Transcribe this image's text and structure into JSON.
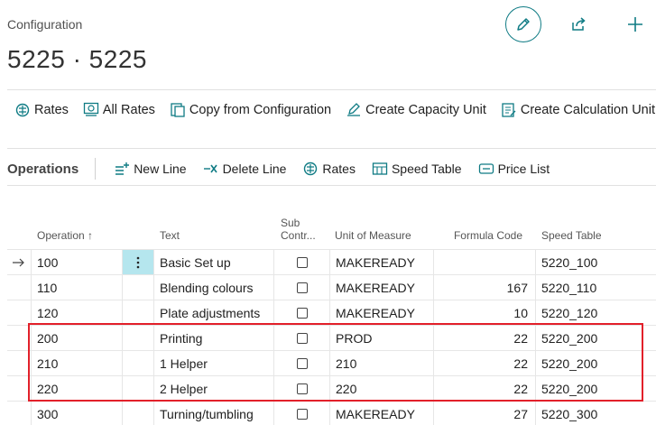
{
  "page": {
    "caption": "Configuration",
    "title": "5225 · 5225"
  },
  "top_actions": {
    "edit_icon": "pencil-icon",
    "share_icon": "share-icon",
    "new_icon": "plus-icon"
  },
  "action_bar": [
    {
      "label": "Rates",
      "icon": "rates-icon"
    },
    {
      "label": "All Rates",
      "icon": "all-rates-icon"
    },
    {
      "label": "Copy from Configuration",
      "icon": "copy-icon"
    },
    {
      "label": "Create Capacity Unit",
      "icon": "create-capacity-icon"
    },
    {
      "label": "Create Calculation Unit",
      "icon": "create-calculation-icon"
    }
  ],
  "operations": {
    "title": "Operations",
    "actions": [
      {
        "label": "New Line",
        "icon": "new-line-icon"
      },
      {
        "label": "Delete Line",
        "icon": "delete-line-icon"
      },
      {
        "label": "Rates",
        "icon": "rates-icon"
      },
      {
        "label": "Speed Table",
        "icon": "speed-table-icon"
      },
      {
        "label": "Price List",
        "icon": "price-list-icon"
      }
    ]
  },
  "table": {
    "columns": {
      "operation": "Operation ↑",
      "text": "Text",
      "sub_contr_1": "Sub",
      "sub_contr_2": "Contr...",
      "unit_of_measure": "Unit of Measure",
      "formula_code": "Formula Code",
      "speed_table": "Speed Table"
    },
    "rows": [
      {
        "operation": "100",
        "text": "Basic Set up",
        "sub_contr": false,
        "unit": "MAKEREADY",
        "formula": "",
        "speed": "5220_100",
        "current": true
      },
      {
        "operation": "110",
        "text": "Blending colours",
        "sub_contr": false,
        "unit": "MAKEREADY",
        "formula": "167",
        "speed": "5220_110"
      },
      {
        "operation": "120",
        "text": "Plate adjustments",
        "sub_contr": false,
        "unit": "MAKEREADY",
        "formula": "10",
        "speed": "5220_120"
      },
      {
        "operation": "200",
        "text": "Printing",
        "sub_contr": false,
        "unit": "PROD",
        "formula": "22",
        "speed": "5220_200"
      },
      {
        "operation": "210",
        "text": "1 Helper",
        "sub_contr": false,
        "unit": "210",
        "formula": "22",
        "speed": "5220_200"
      },
      {
        "operation": "220",
        "text": "2 Helper",
        "sub_contr": false,
        "unit": "220",
        "formula": "22",
        "speed": "5220_200"
      },
      {
        "operation": "300",
        "text": "Turning/tumbling",
        "sub_contr": false,
        "unit": "MAKEREADY",
        "formula": "27",
        "speed": "5220_300"
      }
    ]
  },
  "colors": {
    "accent": "#0f7b84",
    "highlight": "#e2202a",
    "selected_cell": "#b5e6ee"
  }
}
